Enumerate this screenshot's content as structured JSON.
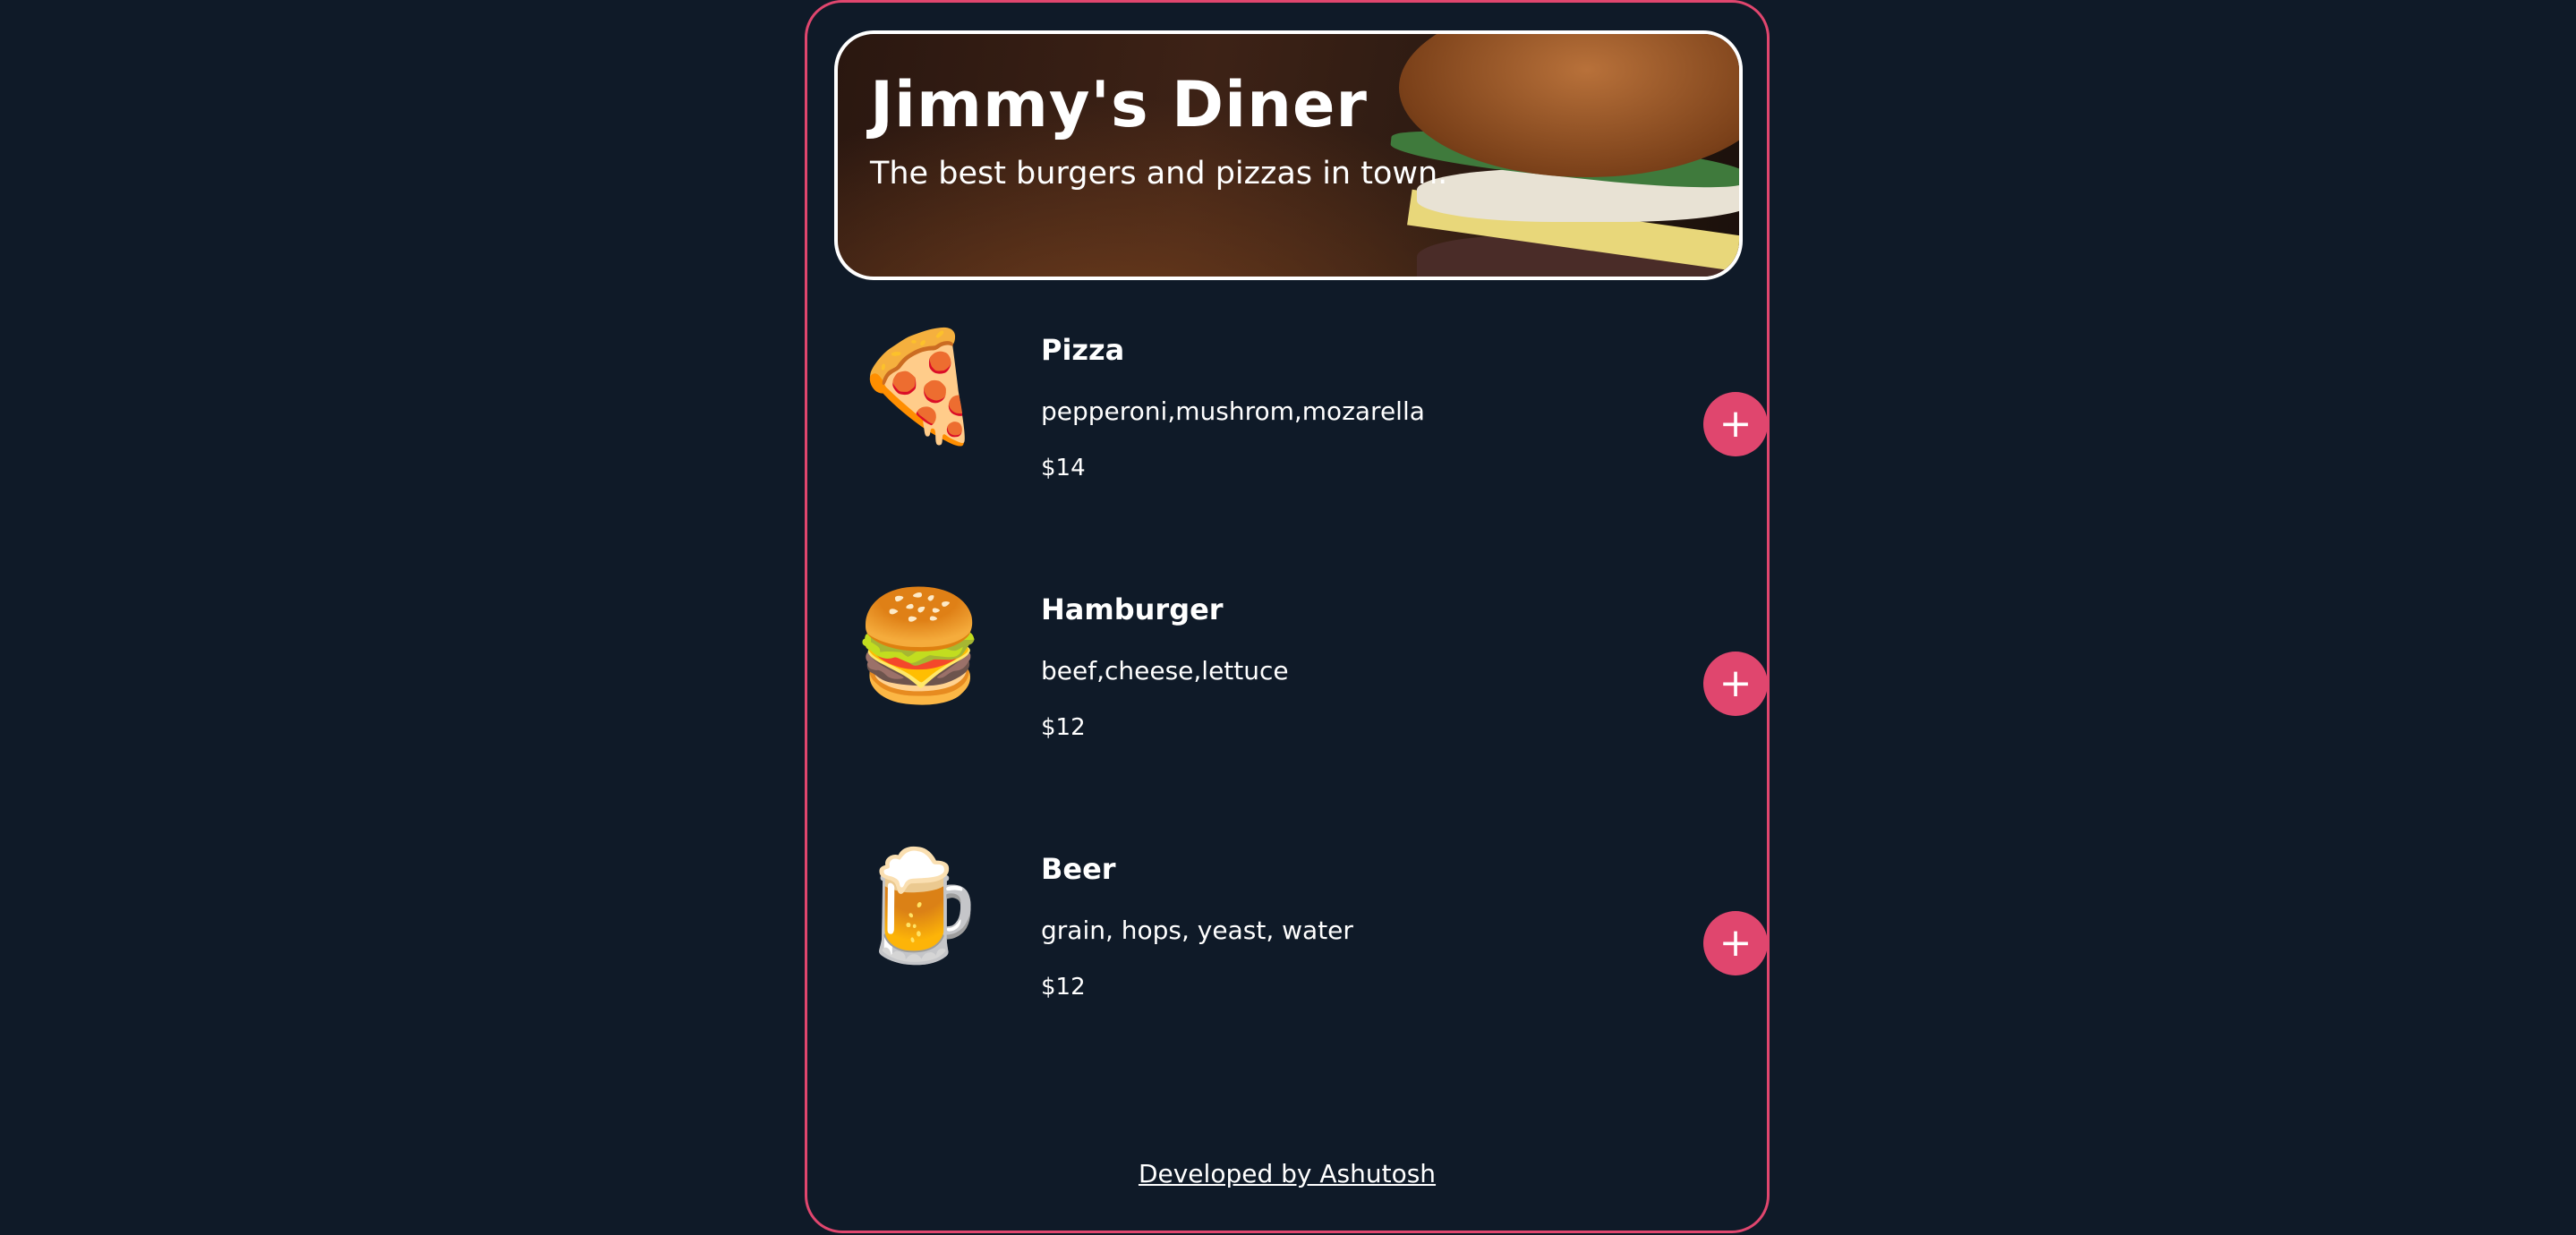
{
  "header": {
    "title": "Jimmy's Diner",
    "subtitle": "The best burgers and pizzas in town."
  },
  "menu": [
    {
      "icon": "pizza-icon",
      "emoji": "🍕",
      "name": "Pizza",
      "ingredients": "pepperoni,mushrom,mozarella",
      "price": "$14",
      "add_label": "+"
    },
    {
      "icon": "hamburger-icon",
      "emoji": "🍔",
      "name": "Hamburger",
      "ingredients": "beef,cheese,lettuce",
      "price": "$12",
      "add_label": "+"
    },
    {
      "icon": "beer-icon",
      "emoji": "🍺",
      "name": "Beer",
      "ingredients": "grain, hops, yeast, water",
      "price": "$12",
      "add_label": "+"
    }
  ],
  "footer": {
    "credit": "Developed by Ashutosh"
  },
  "colors": {
    "accent": "#e0466e",
    "background": "#0f1a28"
  }
}
